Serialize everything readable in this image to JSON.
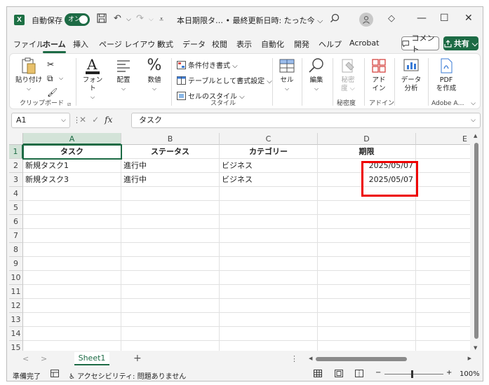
{
  "titlebar": {
    "app_icon_letter": "X",
    "autosave_label": "自動保存",
    "autosave_toggle": "オン",
    "title": "本日期限タ… • 最終更新日時: たった今 ⌵",
    "icons": [
      "save-icon",
      "undo-icon",
      "redo-icon",
      "customize-icon",
      "search-icon",
      "avatar-icon",
      "diamond-icon",
      "minimize-icon",
      "maximize-icon",
      "close-icon"
    ]
  },
  "tabs": [
    "ファイル",
    "ホーム",
    "挿入",
    "ページ レイアウト",
    "数式",
    "データ",
    "校閲",
    "表示",
    "自動化",
    "開発",
    "ヘルプ",
    "Acrobat"
  ],
  "active_tab": "ホーム",
  "comment_label": "コメント",
  "share_label": "共有 ⌵",
  "ribbon": {
    "paste": "貼り付け",
    "clipboard": "クリップボード",
    "font": "フォント",
    "align": "配置",
    "number": "数値",
    "cond_format": "条件付き書式 ⌵",
    "table_format": "テーブルとして書式設定 ⌵",
    "cell_style": "セルのスタイル ⌵",
    "style_group": "スタイル",
    "cells": "セル",
    "edit": "編集",
    "sensitivity_line1": "秘密",
    "sensitivity_line2": "度 ⌵",
    "sensitivity_group": "秘密度",
    "addin_line1": "アド",
    "addin_line2": "イン",
    "addin_group": "アドイン",
    "analyze_line1": "データ",
    "analyze_line2": "分析",
    "pdf_line1": "PDF",
    "pdf_line2": "を作成",
    "adobe_group": "Adobe A…"
  },
  "formula_bar": {
    "name_box": "A1",
    "fx": "fx",
    "formula": "タスク"
  },
  "columns": [
    "A",
    "B",
    "C",
    "D",
    "E"
  ],
  "rows": [
    "1",
    "2",
    "3",
    "4",
    "5",
    "6",
    "7",
    "8",
    "9",
    "10",
    "11",
    "12",
    "13",
    "14",
    "15"
  ],
  "table": {
    "header": [
      "タスク",
      "ステータス",
      "カテゴリー",
      "期限"
    ],
    "data": [
      [
        "新規タスク1",
        "進行中",
        "ビジネス",
        "2025/05/07"
      ],
      [
        "新規タスク3",
        "進行中",
        "ビジネス",
        "2025/05/07"
      ]
    ]
  },
  "sheet_tab": "Sheet1",
  "add_sheet": "+",
  "status": {
    "ready": "準備完了",
    "accessibility": "アクセシビリティ: 問題ありません",
    "zoom": "100%"
  },
  "colors": {
    "accent": "#1d6b45",
    "highlight": "#ee0000"
  }
}
